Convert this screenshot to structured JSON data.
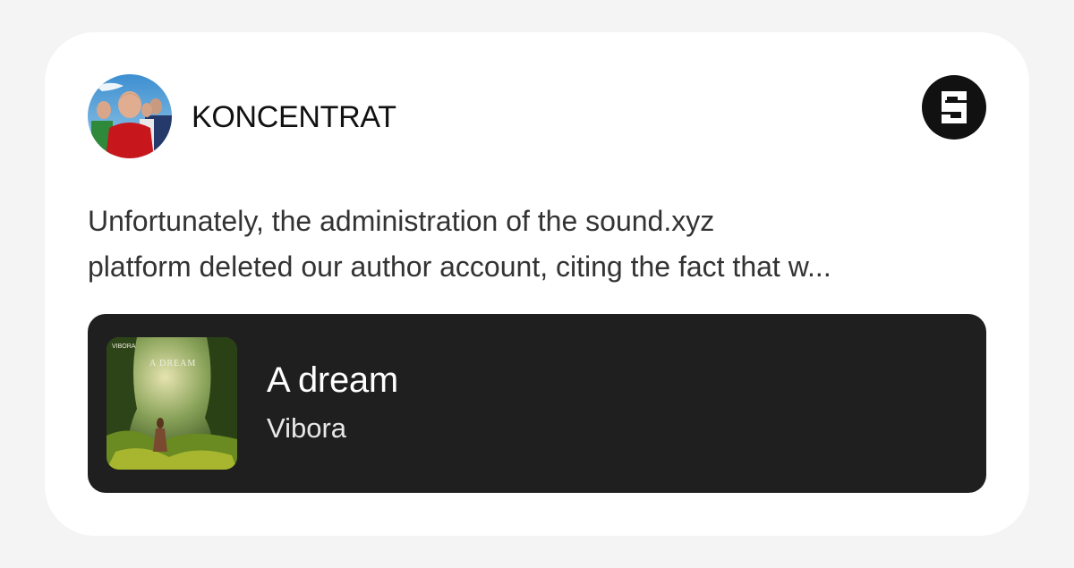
{
  "author": {
    "name": "KONCENTRAT",
    "avatar_icon": "band-photo-avatar"
  },
  "platform": {
    "icon": "sound-xyz-logo-icon"
  },
  "post": {
    "line1": "Unfortunately, the administration of the sound.xyz",
    "line2": "platform deleted our author account, citing the fact that w..."
  },
  "track": {
    "title": "A dream",
    "artist": "Vibora",
    "cover_icon": "jungle-album-cover",
    "cover_text_small": "VIBORA",
    "cover_text_title": "A DREAM"
  },
  "colors": {
    "page_bg": "#f4f4f4",
    "card_bg": "#ffffff",
    "track_bg": "#1f1f1f",
    "logo": "#111111"
  }
}
